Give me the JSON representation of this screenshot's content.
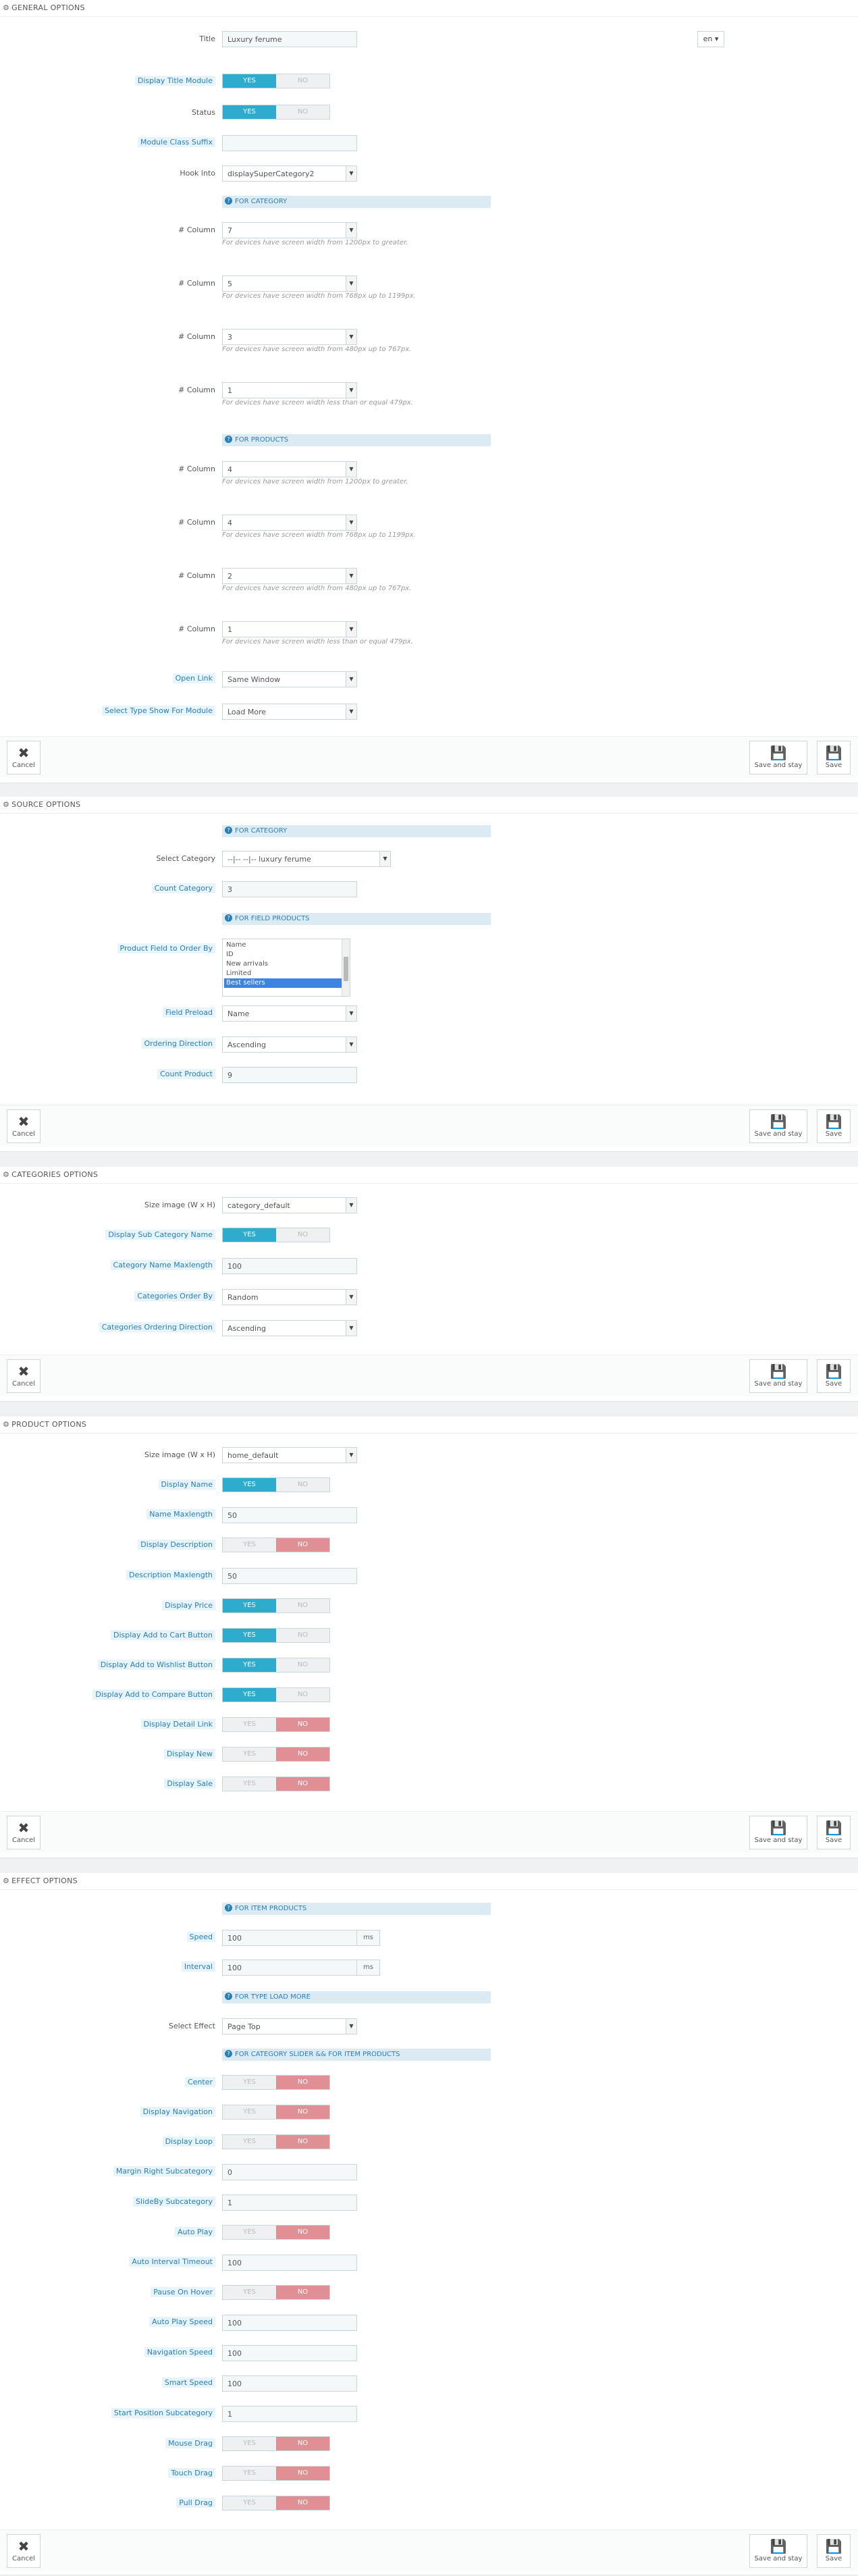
{
  "yes": "YES",
  "no": "NO",
  "cancel": "Cancel",
  "save_and_stay": "Save and stay",
  "save": "Save",
  "general": {
    "heading": "GENERAL OPTIONS",
    "title_label": "Title",
    "title_value": "Luxury ferume",
    "lang": "en",
    "display_title_label": "Display Title Module",
    "status_label": "Status",
    "suffix_label": "Module Class Suffix",
    "suffix_value": "",
    "hook_label": "Hook into",
    "hook_value": "displaySuperCategory2",
    "for_category": "FOR CATEGORY",
    "for_products": "FOR PRODUCTS",
    "column_label": "# Column",
    "cat_cols": [
      "7",
      "5",
      "3",
      "1"
    ],
    "prod_cols": [
      "4",
      "4",
      "2",
      "1"
    ],
    "helps": [
      "For devices have screen width from 1200px to greater.",
      "For devices have screen width from 768px up to 1199px.",
      "For devices have screen width from 480px up to 767px.",
      "For devices have screen width less than or equal 479px."
    ],
    "open_link_label": "Open Link",
    "open_link_value": "Same Window",
    "type_show_label": "Select Type Show For Module",
    "type_show_value": "Load More"
  },
  "source": {
    "heading": "SOURCE OPTIONS",
    "for_category": "FOR CATEGORY",
    "select_category_label": "Select Category",
    "select_category_value": "--|-- --|-- luxury ferume",
    "count_category_label": "Count Category",
    "count_category_value": "3",
    "for_field": "FOR FIELD PRODUCTS",
    "order_by_label": "Product Field to Order By",
    "order_by_options": [
      "Name",
      "ID",
      "New arrivals",
      "Limited",
      "Best sellers"
    ],
    "preload_label": "Field Preload",
    "preload_value": "Name",
    "direction_label": "Ordering Direction",
    "direction_value": "Ascending",
    "count_product_label": "Count Product",
    "count_product_value": "9"
  },
  "categories": {
    "heading": "CATEGORIES OPTIONS",
    "size_label": "Size image (W x H)",
    "size_value": "category_default",
    "sub_name_label": "Display Sub Category Name",
    "maxlength_label": "Category Name Maxlength",
    "maxlength_value": "100",
    "order_label": "Categories Order By",
    "order_value": "Random",
    "direction_label": "Categories Ordering Direction",
    "direction_value": "Ascending"
  },
  "product": {
    "heading": "PRODUCT OPTIONS",
    "size_label": "Size image (W x H)",
    "size_value": "home_default",
    "display_name": "Display Name",
    "name_max_label": "Name Maxlength",
    "name_max_value": "50",
    "display_desc": "Display Description",
    "desc_max_label": "Description Maxlength",
    "desc_max_value": "50",
    "display_price": "Display Price",
    "add_cart": "Display Add to Cart Button",
    "add_wishlist": "Display Add to Wishlist Button",
    "add_compare": "Display Add to Compare Button",
    "detail_link": "Display Detail Link",
    "display_new": "Display New",
    "display_sale": "Display Sale"
  },
  "effect": {
    "heading": "EFFECT OPTIONS",
    "for_item": "FOR ITEM PRODUCTS",
    "speed_label": "Speed",
    "speed_value": "100",
    "ms": "ms",
    "interval_label": "Interval",
    "interval_value": "100",
    "for_type": "FOR TYPE LOAD MORE",
    "effect_label": "Select Effect",
    "effect_value": "Page Top",
    "for_slider": "FOR CATEGORY SLIDER && FOR ITEM PRODUCTS",
    "center": "Center",
    "nav": "Display Navigation",
    "loop": "Display Loop",
    "margin_label": "Margin Right Subcategory",
    "margin_value": "0",
    "slideby_label": "SlideBy Subcategory",
    "slideby_value": "1",
    "autoplay": "Auto Play",
    "auto_interval_label": "Auto Interval Timeout",
    "auto_interval_value": "100",
    "pause": "Pause On Hover",
    "autoplay_speed_label": "Auto Play Speed",
    "autoplay_speed_value": "100",
    "nav_speed_label": "Navigation Speed",
    "nav_speed_value": "100",
    "smart_speed_label": "Smart Speed",
    "smart_speed_value": "100",
    "start_label": "Start Position Subcategory",
    "start_value": "1",
    "mouse_drag": "Mouse Drag",
    "touch_drag": "Touch Drag",
    "pull_drag": "Pull Drag"
  }
}
